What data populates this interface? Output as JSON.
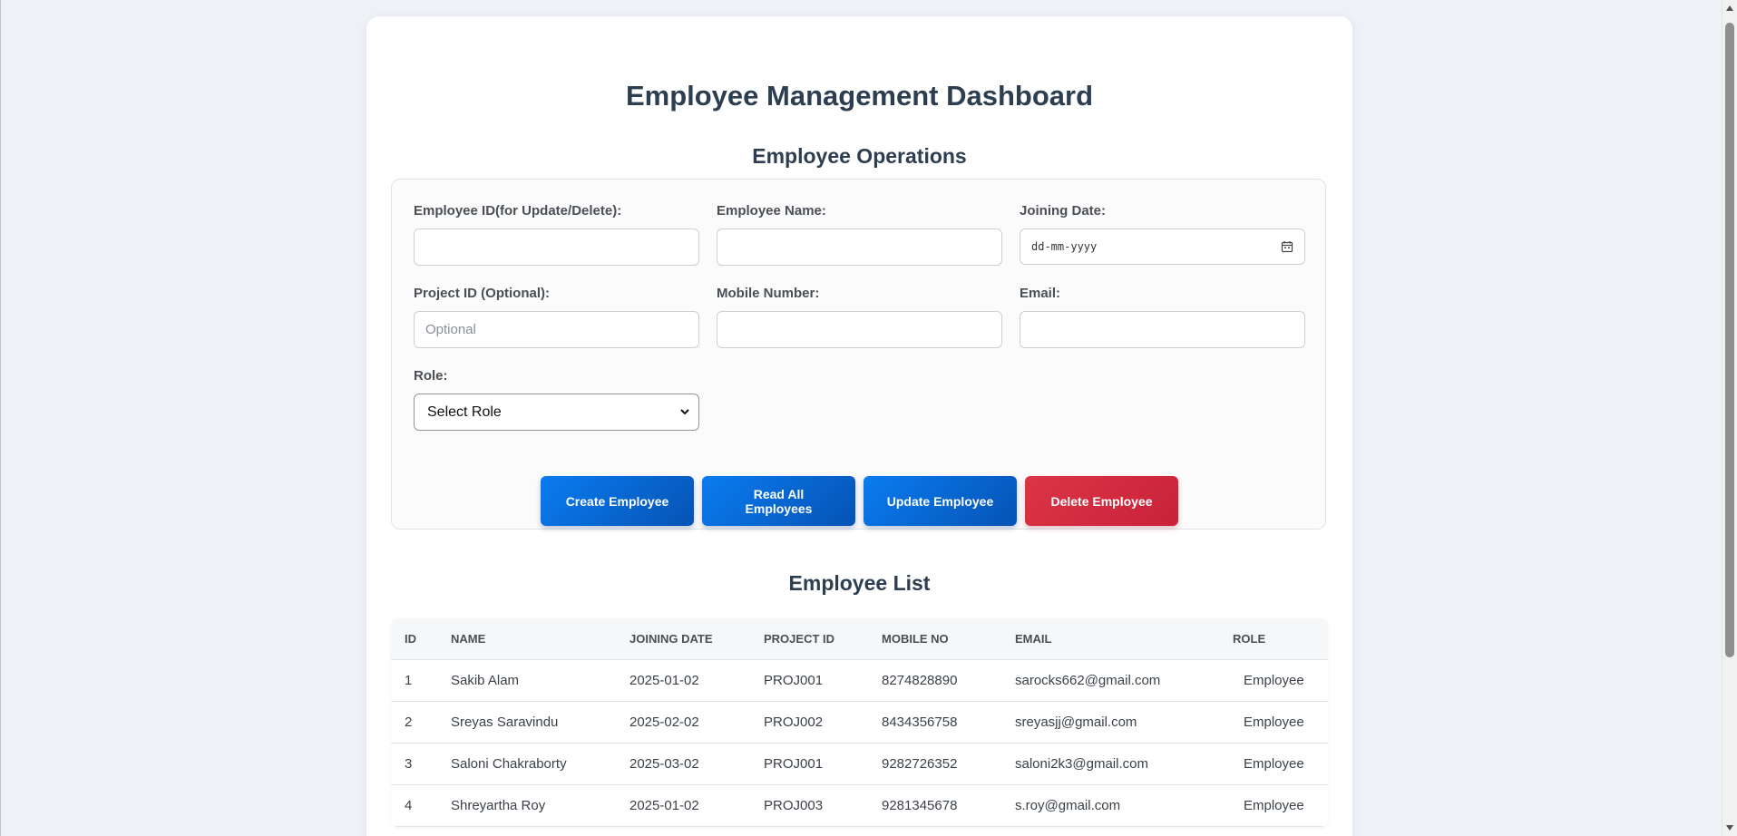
{
  "page": {
    "title": "Employee Management Dashboard",
    "operations_heading": "Employee Operations",
    "list_heading": "Employee List"
  },
  "form": {
    "employee_id": {
      "label": "Employee ID(for Update/Delete):",
      "value": "",
      "placeholder": ""
    },
    "employee_name": {
      "label": "Employee Name:",
      "value": "",
      "placeholder": ""
    },
    "joining_date": {
      "label": "Joining Date:",
      "display": "dd-mm-yyyy"
    },
    "project_id": {
      "label": "Project ID (Optional):",
      "value": "",
      "placeholder": "Optional"
    },
    "mobile_number": {
      "label": "Mobile Number:",
      "value": "",
      "placeholder": ""
    },
    "email": {
      "label": "Email:",
      "value": "",
      "placeholder": ""
    },
    "role": {
      "label": "Role:",
      "selected": "Select Role"
    }
  },
  "buttons": {
    "create": "Create Employee",
    "read_all": "Read All Employees",
    "update": "Update Employee",
    "delete": "Delete Employee"
  },
  "table": {
    "headers": [
      "ID",
      "NAME",
      "JOINING DATE",
      "PROJECT ID",
      "MOBILE NO",
      "EMAIL",
      "ROLE"
    ],
    "rows": [
      [
        "1",
        "Sakib Alam",
        "2025-01-02",
        "PROJ001",
        "8274828890",
        "sarocks662@gmail.com",
        "Employee"
      ],
      [
        "2",
        "Sreyas Saravindu",
        "2025-02-02",
        "PROJ002",
        "8434356758",
        "sreyasjj@gmail.com",
        "Employee"
      ],
      [
        "3",
        "Saloni Chakraborty",
        "2025-03-02",
        "PROJ001",
        "9282726352",
        "saloni2k3@gmail.com",
        "Employee"
      ],
      [
        "4",
        "Shreyartha Roy",
        "2025-01-02",
        "PROJ003",
        "9281345678",
        "s.roy@gmail.com",
        "Employee"
      ]
    ]
  },
  "colors": {
    "primary_button": "#0a6fe0",
    "danger_button": "#dc3545",
    "heading_text": "#2c3e50",
    "page_background": "#eef2f7"
  },
  "icons": {
    "date_picker": "calendar-icon",
    "select_arrow": "chevron-down-icon"
  }
}
